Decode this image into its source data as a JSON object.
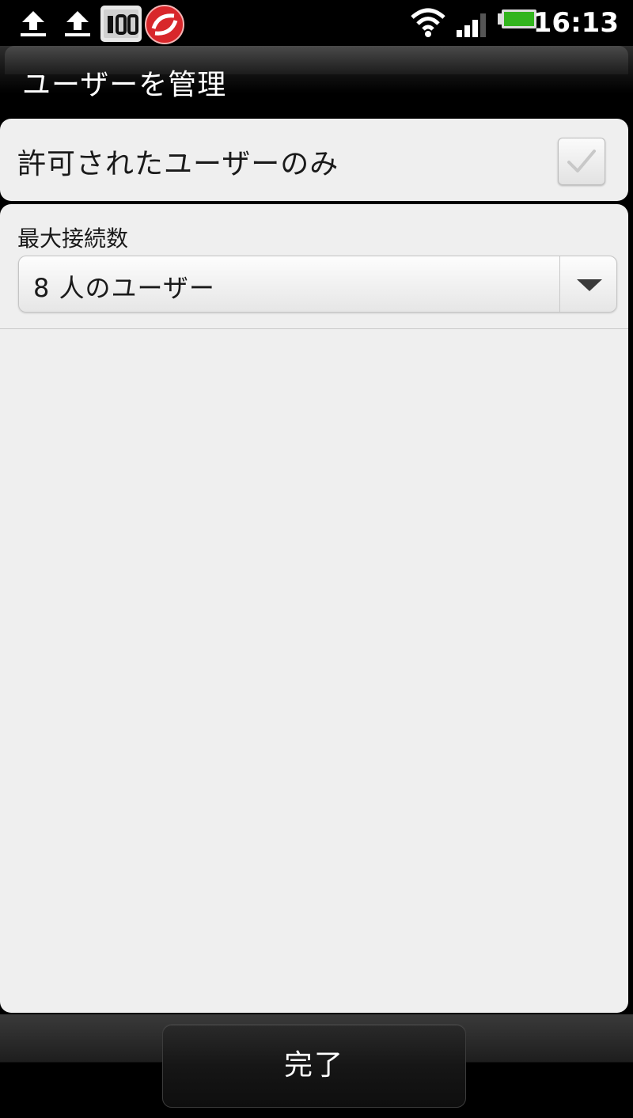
{
  "status_bar": {
    "time": "16:13",
    "icons": [
      "upload-icon",
      "upload-icon",
      "storage-icon",
      "security-app-icon",
      "wifi-icon",
      "signal-icon",
      "battery-icon"
    ]
  },
  "header": {
    "title": "ユーザーを管理"
  },
  "settings": {
    "allowed_users_only": {
      "label": "許可されたユーザーのみ",
      "checked": true
    },
    "max_connections": {
      "label": "最大接続数",
      "selected": "8 人のユーザー"
    }
  },
  "footer": {
    "done_label": "完了"
  }
}
